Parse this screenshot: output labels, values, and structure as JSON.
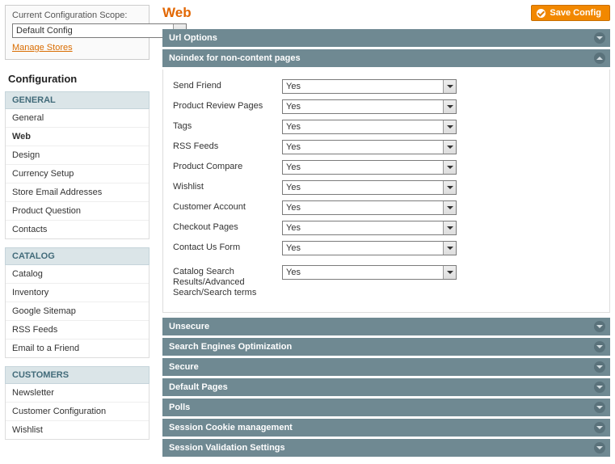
{
  "scope": {
    "label": "Current Configuration Scope:",
    "selected": "Default Config",
    "manage_link": "Manage Stores"
  },
  "config_heading": "Configuration",
  "sidebar_groups": [
    {
      "title": "GENERAL",
      "items": [
        {
          "label": "General",
          "active": false
        },
        {
          "label": "Web",
          "active": true
        },
        {
          "label": "Design",
          "active": false
        },
        {
          "label": "Currency Setup",
          "active": false
        },
        {
          "label": "Store Email Addresses",
          "active": false
        },
        {
          "label": "Product Question",
          "active": false
        },
        {
          "label": "Contacts",
          "active": false
        }
      ]
    },
    {
      "title": "CATALOG",
      "items": [
        {
          "label": "Catalog",
          "active": false
        },
        {
          "label": "Inventory",
          "active": false
        },
        {
          "label": "Google Sitemap",
          "active": false
        },
        {
          "label": "RSS Feeds",
          "active": false
        },
        {
          "label": "Email to a Friend",
          "active": false
        }
      ]
    },
    {
      "title": "CUSTOMERS",
      "items": [
        {
          "label": "Newsletter",
          "active": false
        },
        {
          "label": "Customer Configuration",
          "active": false
        },
        {
          "label": "Wishlist",
          "active": false
        }
      ]
    }
  ],
  "page": {
    "title": "Web",
    "save_button": "Save Config"
  },
  "sections": [
    {
      "title": "Url Options",
      "expanded": false
    },
    {
      "title": "Noindex for non-content pages",
      "expanded": true,
      "fields": [
        {
          "label": "Send Friend",
          "value": "Yes"
        },
        {
          "label": "Product Review Pages",
          "value": "Yes"
        },
        {
          "label": "Tags",
          "value": "Yes"
        },
        {
          "label": "RSS Feeds",
          "value": "Yes"
        },
        {
          "label": "Product Compare",
          "value": "Yes"
        },
        {
          "label": "Wishlist",
          "value": "Yes"
        },
        {
          "label": "Customer Account",
          "value": "Yes"
        },
        {
          "label": "Checkout Pages",
          "value": "Yes"
        },
        {
          "label": "Contact Us Form",
          "value": "Yes"
        },
        {
          "label": "Catalog Search Results/Advanced Search/Search terms",
          "value": "Yes"
        }
      ]
    },
    {
      "title": "Unsecure",
      "expanded": false
    },
    {
      "title": "Search Engines Optimization",
      "expanded": false
    },
    {
      "title": "Secure",
      "expanded": false
    },
    {
      "title": "Default Pages",
      "expanded": false
    },
    {
      "title": "Polls",
      "expanded": false
    },
    {
      "title": "Session Cookie management",
      "expanded": false
    },
    {
      "title": "Session Validation Settings",
      "expanded": false
    }
  ]
}
